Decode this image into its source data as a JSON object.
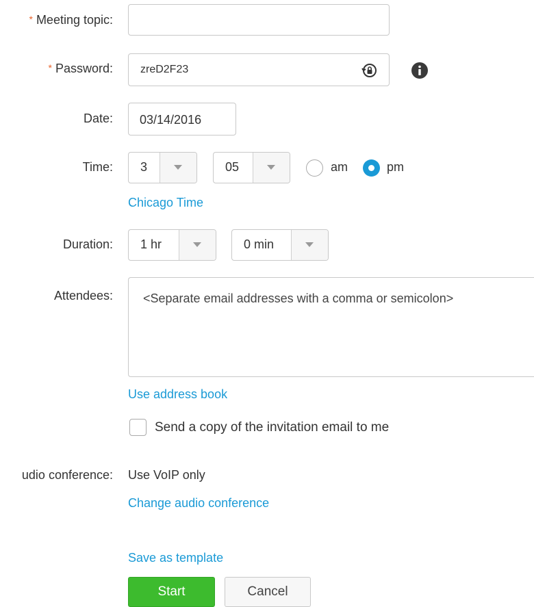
{
  "form": {
    "required_marker": "*",
    "meeting_topic": {
      "label": "Meeting topic:",
      "value": ""
    },
    "password": {
      "label": "Password:",
      "value": "zreD2F23"
    },
    "date": {
      "label": "Date:",
      "value": "03/14/2016"
    },
    "time": {
      "label": "Time:",
      "hour": "3",
      "minute": "05",
      "am_label": "am",
      "pm_label": "pm",
      "selected_period": "pm",
      "timezone_link": "Chicago Time"
    },
    "duration": {
      "label": "Duration:",
      "hours": "1 hr",
      "minutes": "0 min"
    },
    "attendees": {
      "label": "Attendees:",
      "placeholder": "<Separate email addresses with a comma or semicolon>",
      "address_book_link": "Use address book",
      "send_copy_label": "Send a copy of the invitation email to me",
      "send_copy_checked": false
    },
    "audio_conference": {
      "label": "udio conference:",
      "value": "Use VoIP only",
      "change_link": "Change audio conference"
    },
    "save_template_link": "Save as template",
    "start_button": "Start",
    "cancel_button": "Cancel"
  },
  "colors": {
    "accent": "#1a9ad6",
    "required": "#e8632b",
    "start_button": "#3dbb2e"
  },
  "icons": {
    "password": "regenerate-password-icon",
    "info": "info-icon"
  }
}
